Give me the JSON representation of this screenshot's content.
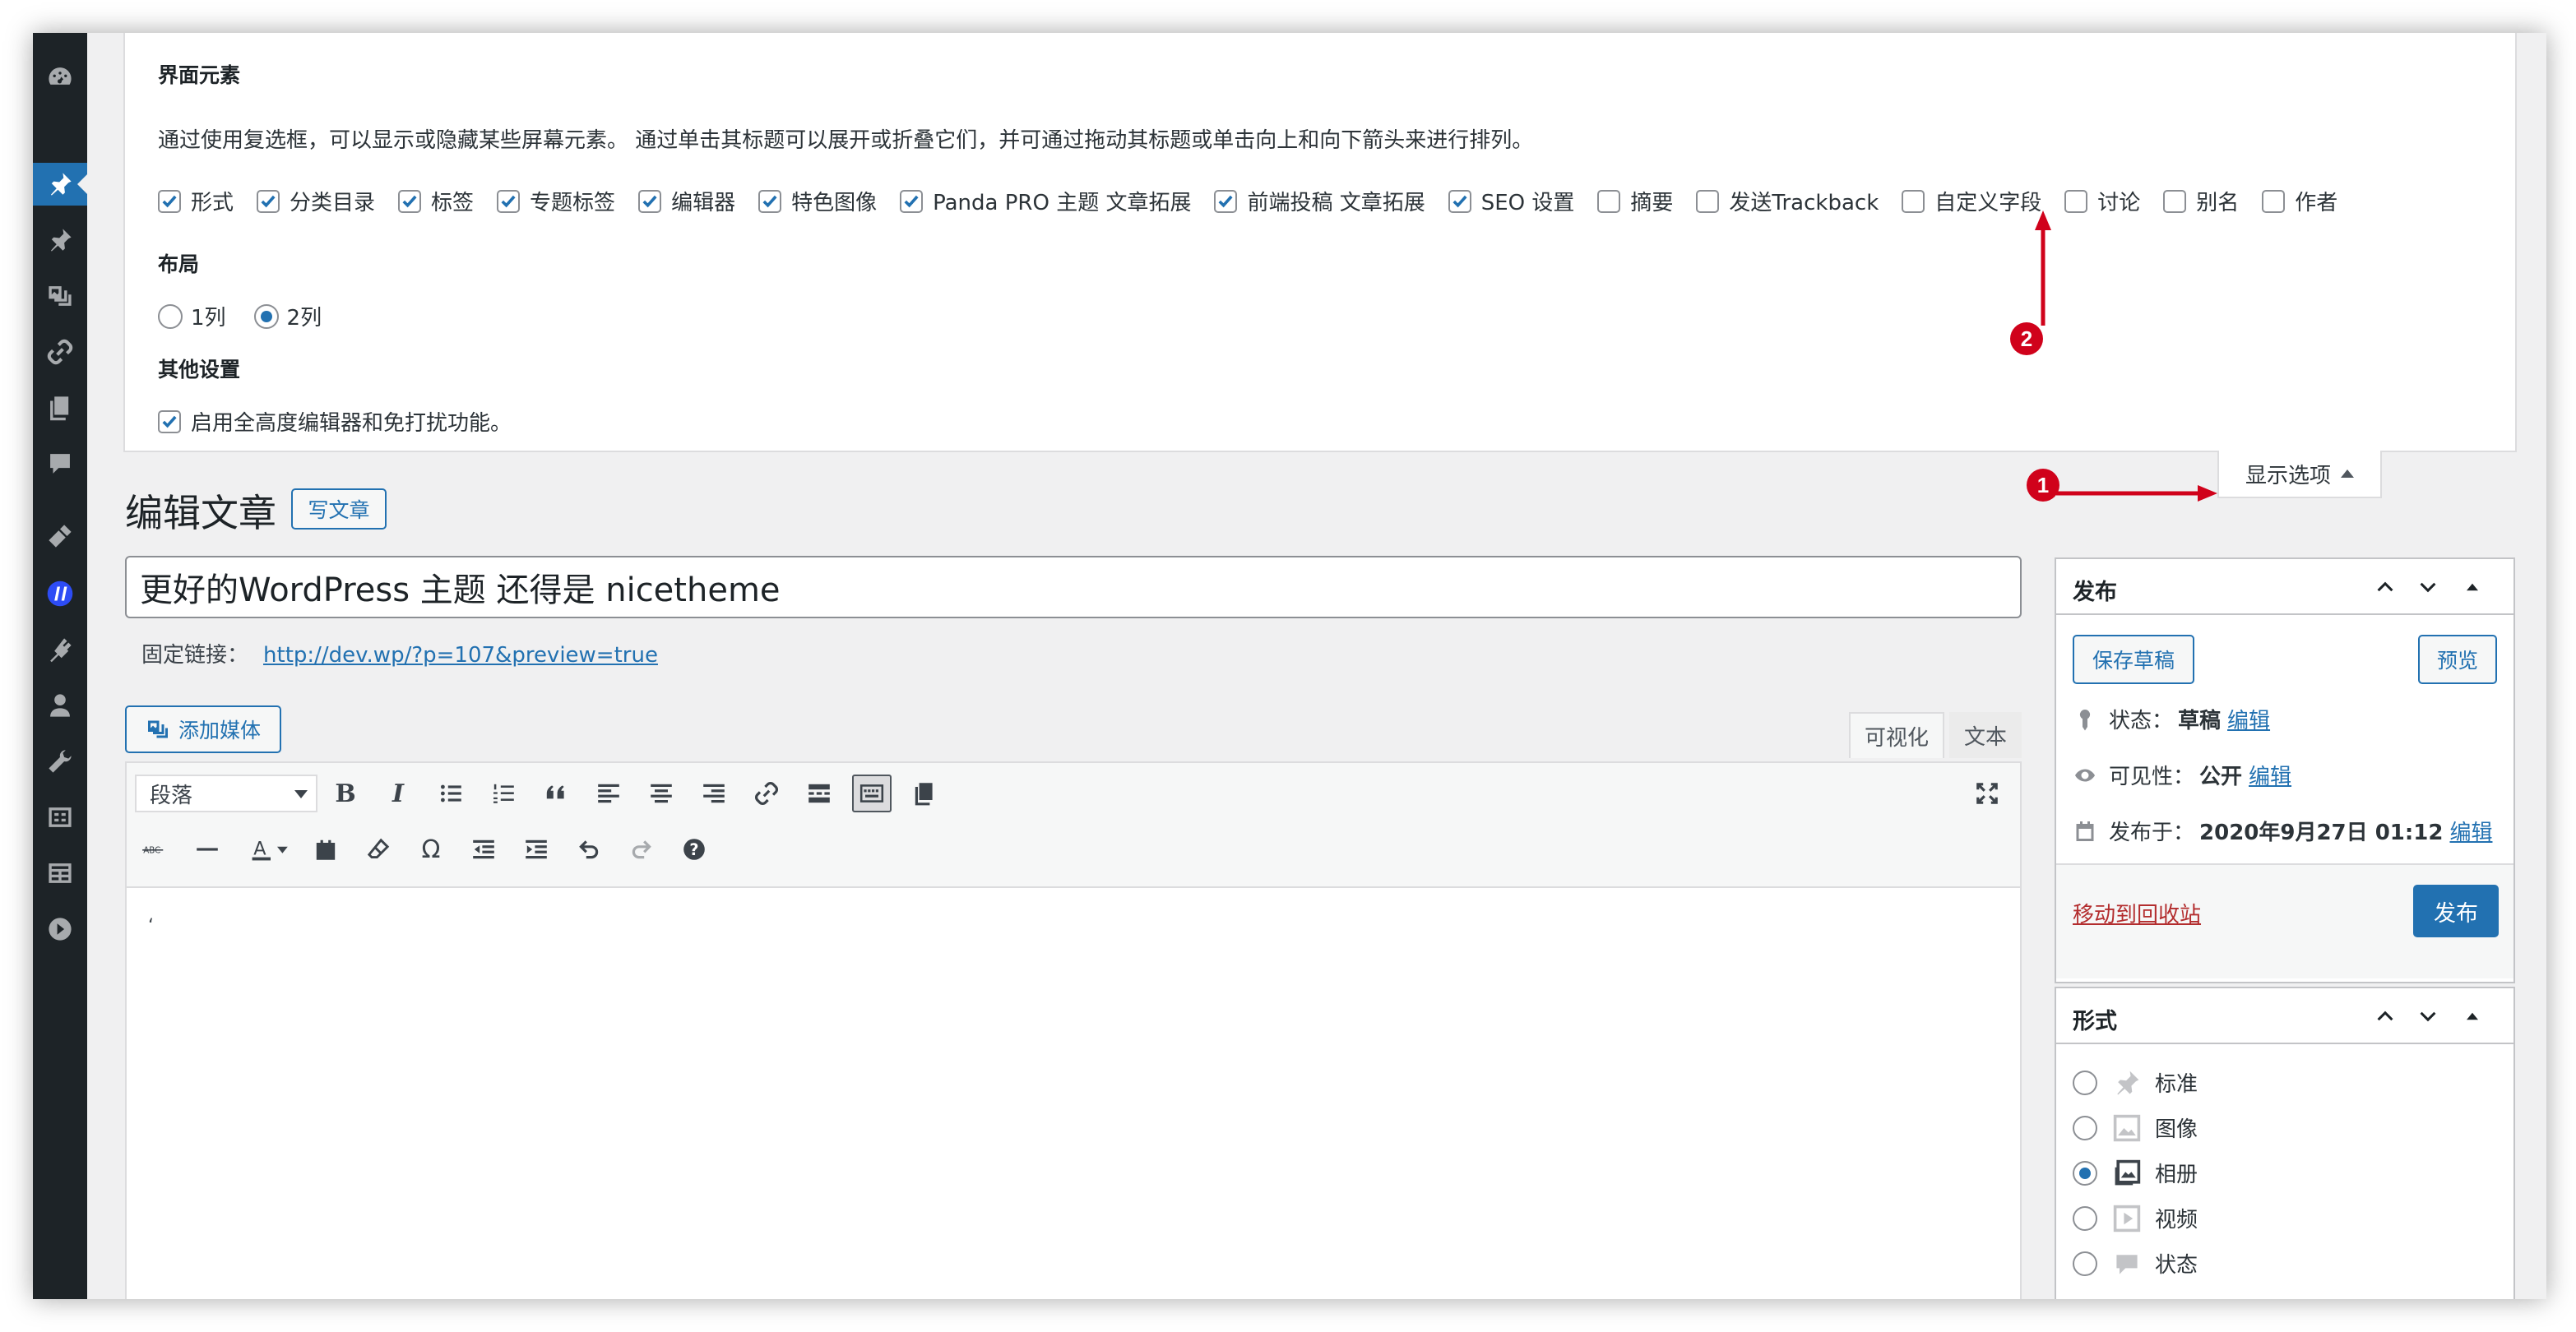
{
  "screen_options": {
    "heading_elements": "界面元素",
    "description": "通过使用复选框，可以显示或隐藏某些屏幕元素。 通过单击其标题可以展开或折叠它们，并可通过拖动其标题或单击向上和向下箭头来进行排列。",
    "elements": [
      {
        "label": "形式",
        "checked": true
      },
      {
        "label": "分类目录",
        "checked": true
      },
      {
        "label": "标签",
        "checked": true
      },
      {
        "label": "专题标签",
        "checked": true
      },
      {
        "label": "编辑器",
        "checked": true
      },
      {
        "label": "特色图像",
        "checked": true
      },
      {
        "label": "Panda PRO 主题 文章拓展",
        "checked": true
      },
      {
        "label": "前端投稿 文章拓展",
        "checked": true
      },
      {
        "label": "SEO 设置",
        "checked": true
      },
      {
        "label": "摘要",
        "checked": false
      },
      {
        "label": "发送Trackback",
        "checked": false
      },
      {
        "label": "自定义字段",
        "checked": false
      },
      {
        "label": "讨论",
        "checked": false
      },
      {
        "label": "别名",
        "checked": false
      },
      {
        "label": "作者",
        "checked": false
      }
    ],
    "heading_layout": "布局",
    "layout": [
      {
        "label": "1列",
        "selected": false
      },
      {
        "label": "2列",
        "selected": true
      }
    ],
    "heading_other": "其他设置",
    "other": {
      "label": "启用全高度编辑器和免打扰功能。",
      "checked": true
    },
    "toggle_label": "显示选项"
  },
  "annotations": {
    "badge_1": "1",
    "badge_2": "2",
    "color": "#d0021b"
  },
  "page": {
    "title": "编辑文章",
    "add_new": "写文章",
    "post_title": "更好的WordPress 主题 还得是 nicetheme",
    "permalink_label": "固定链接：",
    "permalink_url": "http://dev.wp/?p=107&preview=true"
  },
  "editor": {
    "add_media": "添加媒体",
    "tab_visual": "可视化",
    "tab_text": "文本",
    "format_select": "段落",
    "content": "‘"
  },
  "publish_box": {
    "title": "发布",
    "save_draft": "保存草稿",
    "preview": "预览",
    "status_label": "状态：",
    "status_value": "草稿",
    "visibility_label": "可见性：",
    "visibility_value": "公开",
    "date_label": "发布于：",
    "date_value": "2020年9月27日 01:12",
    "edit_link": "编辑",
    "trash": "移动到回收站",
    "publish": "发布"
  },
  "format_box": {
    "title": "形式",
    "options": [
      {
        "label": "标准",
        "icon": "pin-icon",
        "selected": false
      },
      {
        "label": "图像",
        "icon": "image-icon",
        "selected": false
      },
      {
        "label": "相册",
        "icon": "gallery-icon",
        "selected": true
      },
      {
        "label": "视频",
        "icon": "video-icon",
        "selected": false
      },
      {
        "label": "状态",
        "icon": "status-icon",
        "selected": false
      }
    ]
  },
  "colors": {
    "accent": "#2271b1",
    "sidebar": "#1d2327",
    "trash": "#b32d2e"
  }
}
